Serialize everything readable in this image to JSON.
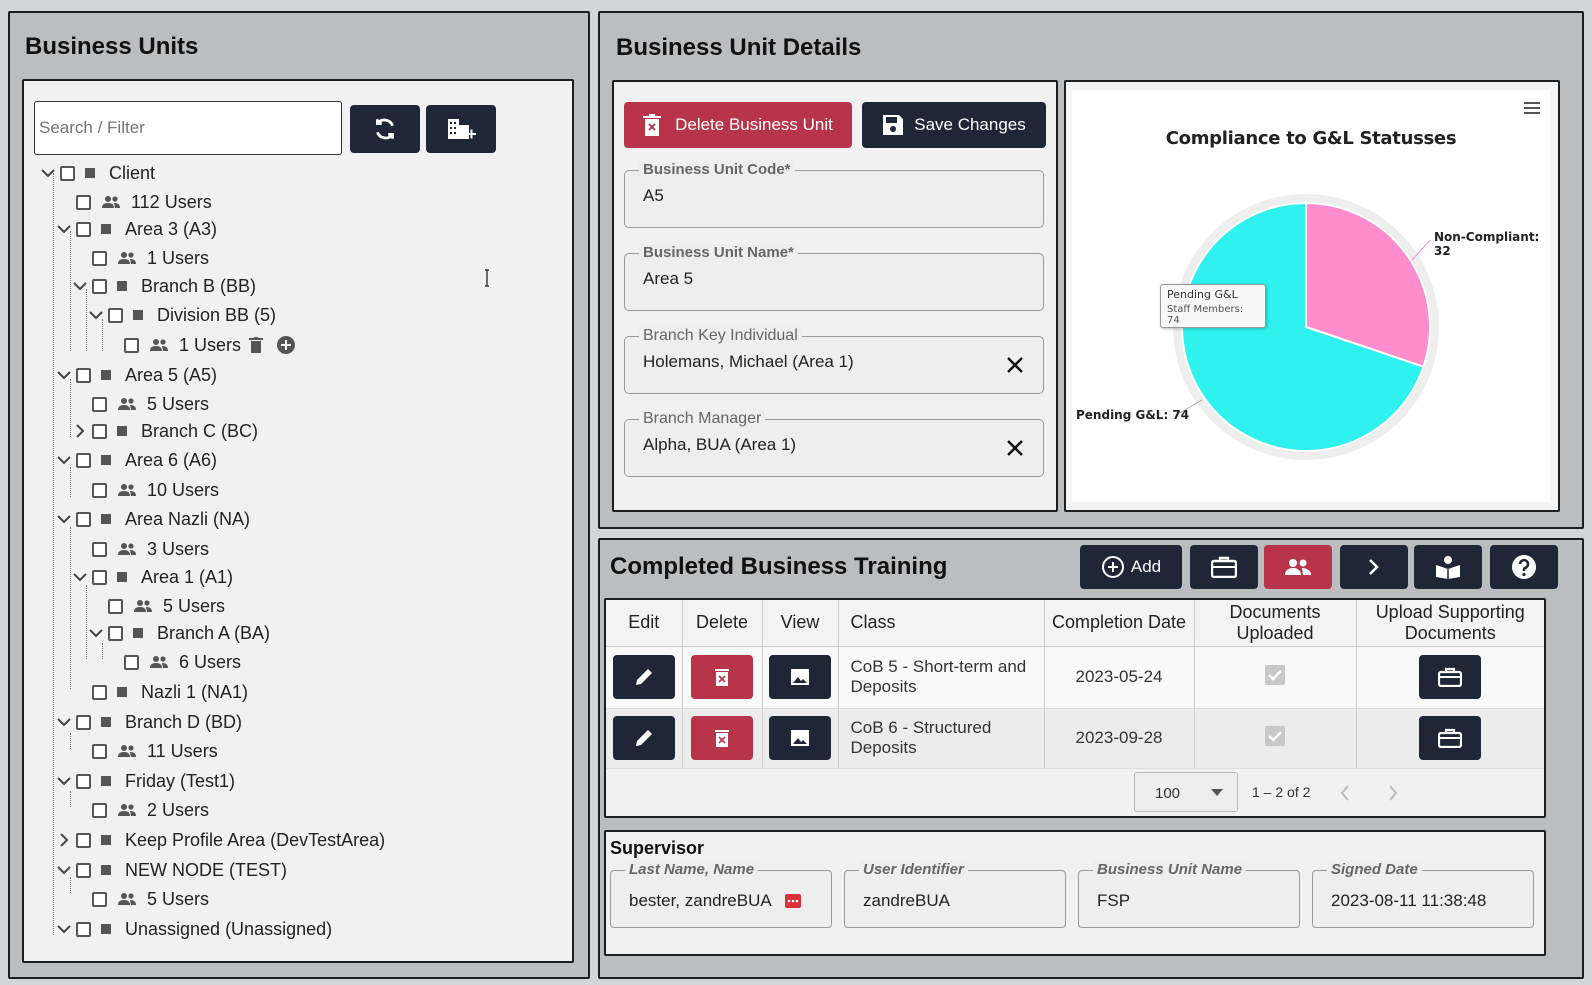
{
  "business_units": {
    "title": "Business Units",
    "search_placeholder": "Search / Filter",
    "tree": [
      {
        "label": "Client",
        "kind": "node",
        "expanded": true
      },
      {
        "label": "112 Users",
        "kind": "users"
      },
      {
        "label": "Area 3 (A3)",
        "kind": "node",
        "expanded": true
      },
      {
        "label": "1 Users",
        "kind": "users"
      },
      {
        "label": "Branch B (BB)",
        "kind": "node",
        "expanded": true
      },
      {
        "label": "Division BB (5)",
        "kind": "node",
        "expanded": true
      },
      {
        "label": "1 Users",
        "kind": "users"
      },
      {
        "label": "Area 5 (A5)",
        "kind": "node",
        "expanded": true
      },
      {
        "label": "5 Users",
        "kind": "users"
      },
      {
        "label": "Branch C (BC)",
        "kind": "node",
        "expanded": false
      },
      {
        "label": "Area 6 (A6)",
        "kind": "node",
        "expanded": true
      },
      {
        "label": "10 Users",
        "kind": "users"
      },
      {
        "label": "Area Nazli (NA)",
        "kind": "node",
        "expanded": true
      },
      {
        "label": "3 Users",
        "kind": "users"
      },
      {
        "label": "Area 1 (A1)",
        "kind": "node",
        "expanded": true
      },
      {
        "label": "5 Users",
        "kind": "users"
      },
      {
        "label": "Branch A (BA)",
        "kind": "node",
        "expanded": true
      },
      {
        "label": "6 Users",
        "kind": "users"
      },
      {
        "label": "Nazli 1 (NA1)",
        "kind": "node"
      },
      {
        "label": "Branch D (BD)",
        "kind": "node",
        "expanded": true
      },
      {
        "label": "11 Users",
        "kind": "users"
      },
      {
        "label": "Friday (Test1)",
        "kind": "node",
        "expanded": true
      },
      {
        "label": "2 Users",
        "kind": "users"
      },
      {
        "label": "Keep Profile Area (DevTestArea)",
        "kind": "node",
        "expanded": false
      },
      {
        "label": "NEW NODE (TEST)",
        "kind": "node",
        "expanded": true
      },
      {
        "label": "5 Users",
        "kind": "users"
      },
      {
        "label": "Unassigned (Unassigned)",
        "kind": "node",
        "expanded": true
      }
    ]
  },
  "details": {
    "title": "Business Unit Details",
    "delete_label": "Delete Business Unit",
    "save_label": "Save Changes",
    "code_label": "Business Unit Code*",
    "code_value": "A5",
    "name_label": "Business Unit Name*",
    "name_value": "Area 5",
    "key_individual_label": "Branch Key Individual",
    "key_individual_value": "Holemans, Michael (Area 1)",
    "manager_label": "Branch Manager",
    "manager_value": "Alpha, BUA (Area 1)"
  },
  "chart_data": {
    "type": "pie",
    "title": "Compliance to G&L Statusses",
    "slices": [
      {
        "label": "Non-Compliant",
        "value": 32,
        "color": "#ff8ccc"
      },
      {
        "label": "Pending G&L",
        "value": 74,
        "color": "#2ff2ef"
      }
    ],
    "data_labels": [
      "Non-Compliant: 32",
      "Pending G&L: 74"
    ],
    "tooltip": {
      "title": "Pending G&L",
      "text": "Staff Members: 74"
    }
  },
  "training": {
    "title": "Completed Business Training",
    "add_label": "Add",
    "columns": [
      "Edit",
      "Delete",
      "View",
      "Class",
      "Completion Date",
      "Documents Uploaded",
      "Upload Supporting Documents"
    ],
    "rows": [
      {
        "class": "CoB 5 - Short-term and Deposits",
        "date": "2023-05-24",
        "uploaded": true
      },
      {
        "class": "CoB 6 - Structured Deposits",
        "date": "2023-09-28",
        "uploaded": true
      }
    ],
    "page_size": "100",
    "range_text": "1 – 2 of 2"
  },
  "supervisor": {
    "title": "Supervisor",
    "name_label": "Last Name, Name",
    "name_value": "bester, zandreBUA",
    "id_label": "User Identifier",
    "id_value": "zandreBUA",
    "bu_label": "Business Unit Name",
    "bu_value": "FSP",
    "date_label": "Signed Date",
    "date_value": "2023-08-11 11:38:48"
  },
  "colors": {
    "accent_dark": "#1f2737",
    "accent_red": "#b8344a",
    "pie_cyan": "#2ff2ef",
    "pie_pink": "#ff8ccc"
  }
}
